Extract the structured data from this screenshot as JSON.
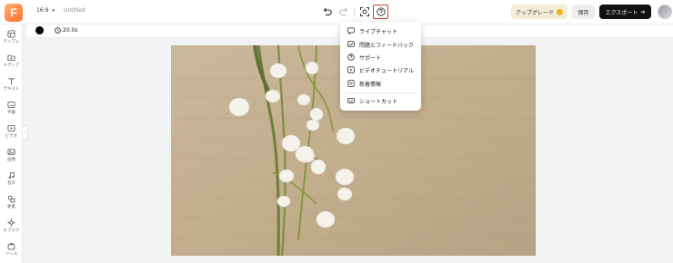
{
  "app": {
    "logo_letter": "F",
    "aspect_ratio": "16:9",
    "document_title": "Untitled"
  },
  "header": {
    "upgrade_label": "アップグレード",
    "save_label": "保存",
    "export_label": "エクスポート"
  },
  "sidebar": {
    "items": [
      {
        "label": "テンプレ",
        "icon": "template-icon"
      },
      {
        "label": "メディア",
        "icon": "media-folder-icon"
      },
      {
        "label": "テキスト",
        "icon": "text-icon"
      },
      {
        "label": "字幕",
        "icon": "subtitle-icon"
      },
      {
        "label": "ビデオ",
        "icon": "video-icon"
      },
      {
        "label": "画像",
        "icon": "image-icon"
      },
      {
        "label": "音声",
        "icon": "music-icon"
      },
      {
        "label": "要素",
        "icon": "elements-icon"
      },
      {
        "label": "エフェク",
        "icon": "effects-icon"
      },
      {
        "label": "ツール",
        "icon": "tools-icon"
      }
    ]
  },
  "toolbar": {
    "background_color": "#000000",
    "duration": "20.0s"
  },
  "help_menu": {
    "items": [
      {
        "label": "ライブチャット",
        "icon": "chat-icon"
      },
      {
        "label": "問題とフィードバック",
        "icon": "feedback-icon"
      },
      {
        "label": "サポート",
        "icon": "support-icon"
      },
      {
        "label": "ビデオチュートリアル",
        "icon": "video-tutorial-icon"
      },
      {
        "label": "新着情報",
        "icon": "news-icon"
      },
      {
        "label": "ショートカット",
        "icon": "keyboard-icon"
      }
    ]
  },
  "colors": {
    "accent_highlight": "#e0362c",
    "export_button": "#111111",
    "upgrade_button": "#f3ecd9"
  }
}
